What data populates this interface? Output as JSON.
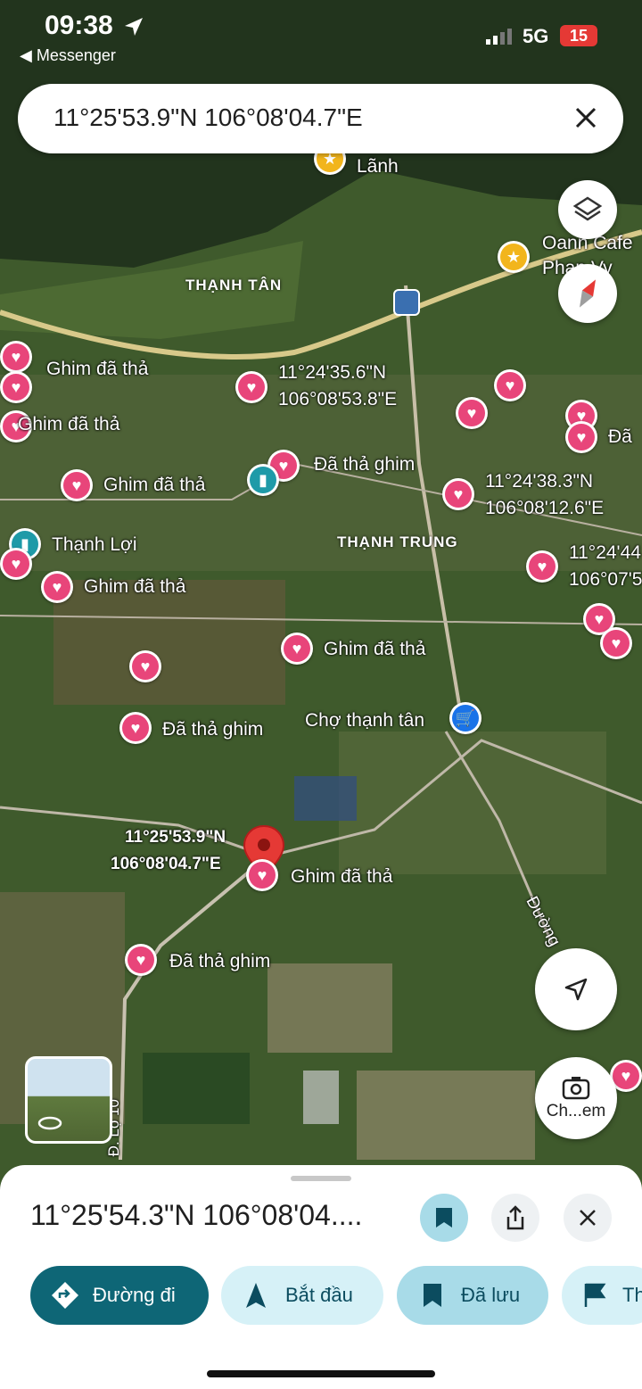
{
  "status_bar": {
    "time": "09:38",
    "back_app": "Messenger",
    "network": "5G",
    "battery": "15"
  },
  "search": {
    "query": "11°25'53.9\"N 106°08'04.7\"E"
  },
  "map": {
    "area_labels": [
      "THẠNH TÂN",
      "THẠNH TRUNG"
    ],
    "pins": [
      {
        "label": "Lãnh",
        "kind": "star"
      },
      {
        "label": "Oann Cafe",
        "kind": "star"
      },
      {
        "label": "Phan Vy",
        "kind": "text"
      },
      {
        "label": "Ghim đã thả",
        "kind": "heart"
      },
      {
        "label": "11°24'35.6\"N",
        "kind": "heart"
      },
      {
        "label": "106°08'53.8\"E",
        "kind": "text"
      },
      {
        "label": "Ghim đã thả",
        "kind": "heart"
      },
      {
        "label": "Đã",
        "kind": "heart"
      },
      {
        "label": "Đã thả ghim",
        "kind": "heart"
      },
      {
        "label": "Ghim đã thả",
        "kind": "heart"
      },
      {
        "label": "11°24'38.3\"N",
        "kind": "heart"
      },
      {
        "label": "106°08'12.6\"E",
        "kind": "text"
      },
      {
        "label": "Thạnh Lợi",
        "kind": "bookmark"
      },
      {
        "label": "11°24'44",
        "kind": "heart"
      },
      {
        "label": "106°07'5",
        "kind": "text"
      },
      {
        "label": "Ghim đã thả",
        "kind": "heart"
      },
      {
        "label": "Ghim đã thả",
        "kind": "heart"
      },
      {
        "label": "Chợ thạnh tân",
        "kind": "shop"
      },
      {
        "label": "Đã thả ghim",
        "kind": "heart"
      },
      {
        "label": "11°25'53.9\"N",
        "kind": "selected"
      },
      {
        "label": "106°08'04.7\"E",
        "kind": "text"
      },
      {
        "label": "Ghim đã thả",
        "kind": "heart"
      },
      {
        "label": "Đã thả ghim",
        "kind": "heart"
      },
      {
        "label": "Đường",
        "kind": "road"
      },
      {
        "label": "Đ. Lộ 10",
        "kind": "road"
      }
    ],
    "camera_label": "Ch...em"
  },
  "sheet": {
    "title": "11°25'54.3\"N 106°08'04....",
    "actions": [
      "Đường đi",
      "Bắt đầu",
      "Đã lưu",
      "Th"
    ]
  }
}
